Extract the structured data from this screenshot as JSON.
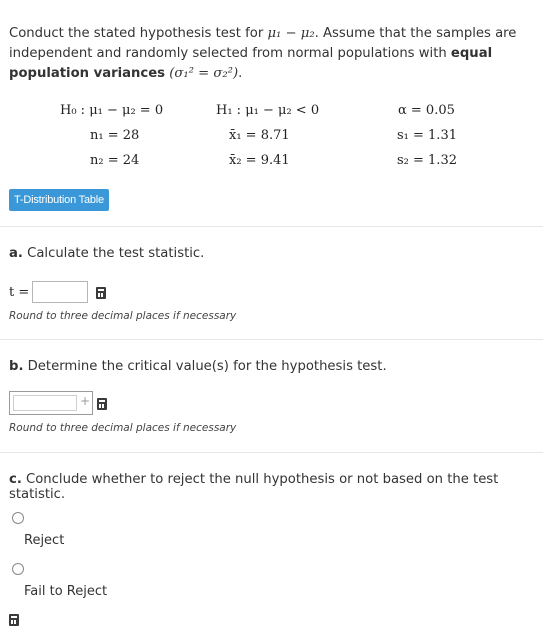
{
  "intro": {
    "text1": "Conduct the stated hypothesis test for ",
    "mu_expr": "μ₁ − μ₂",
    "text2": ". Assume that the samples are independent and randomly selected from normal populations with ",
    "bold1": "equal population variances",
    "var_expr": "(σ₁² = σ₂²)",
    "period": "."
  },
  "hypotheses": {
    "h0": "H₀ : μ₁ − μ₂ = 0",
    "h1": "H₁ : μ₁ − μ₂ < 0",
    "alpha": "α = 0.05",
    "n1": "n₁ = 28",
    "xbar1": "x̄₁ = 8.71",
    "s1": "s₁ = 1.31",
    "n2": "n₂ = 24",
    "xbar2": "x̄₂ = 9.41",
    "s2": "s₂ = 1.32"
  },
  "tdist_button": "T-Distribution Table",
  "part_a": {
    "letter": "a.",
    "question": "Calculate the test statistic.",
    "label": "t =",
    "value": "",
    "hint": "Round to three decimal places if necessary"
  },
  "part_b": {
    "letter": "b.",
    "question": "Determine the critical value(s) for the hypothesis test.",
    "plus": "+",
    "value": "",
    "hint": "Round to three decimal places if necessary"
  },
  "part_c": {
    "letter": "c.",
    "question": "Conclude whether to reject the null hypothesis or not based on the test statistic.",
    "options": [
      "Reject",
      "Fail to Reject"
    ]
  }
}
